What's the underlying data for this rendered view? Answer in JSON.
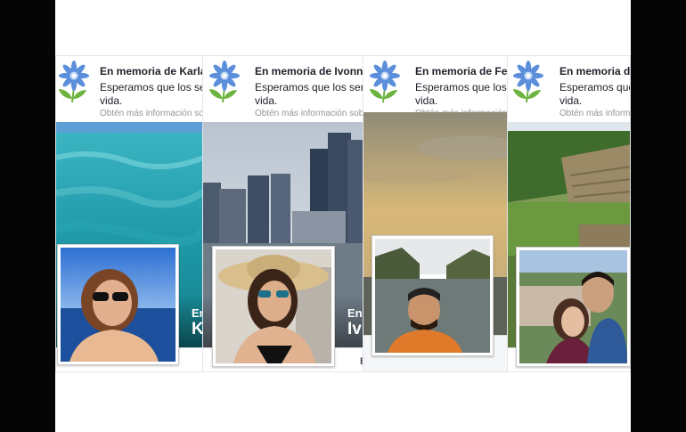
{
  "cards": [
    {
      "title": "En memoria de Karla",
      "message_line1": "Esperamos que los ser",
      "message_line2": "vida.",
      "more_link": "Obtén más información sob",
      "cover_label_line1": "En",
      "cover_label_line2": "K"
    },
    {
      "title": "En memoria de Ivonne",
      "message_line1": "Esperamos que los sere",
      "message_line2": "vida.",
      "more_link": "Obtén más información sob",
      "cover_label_line1": "En",
      "cover_label_line2": "Iv",
      "bottom_label": "B"
    },
    {
      "title": "En memoria de Fer",
      "message_line1": "Esperamos que los s",
      "message_line2": "vida.",
      "more_link": "Obtén más información s"
    },
    {
      "title": "En memoria de",
      "message_line1": "Esperamos que",
      "message_line2": "vida.",
      "more_link": "Obtén más informac"
    }
  ],
  "colors": {
    "petal": "#5b8fdc",
    "leaf": "#6cb33f",
    "side_bars": "#050505"
  },
  "icon": "memorial-flower-icon"
}
